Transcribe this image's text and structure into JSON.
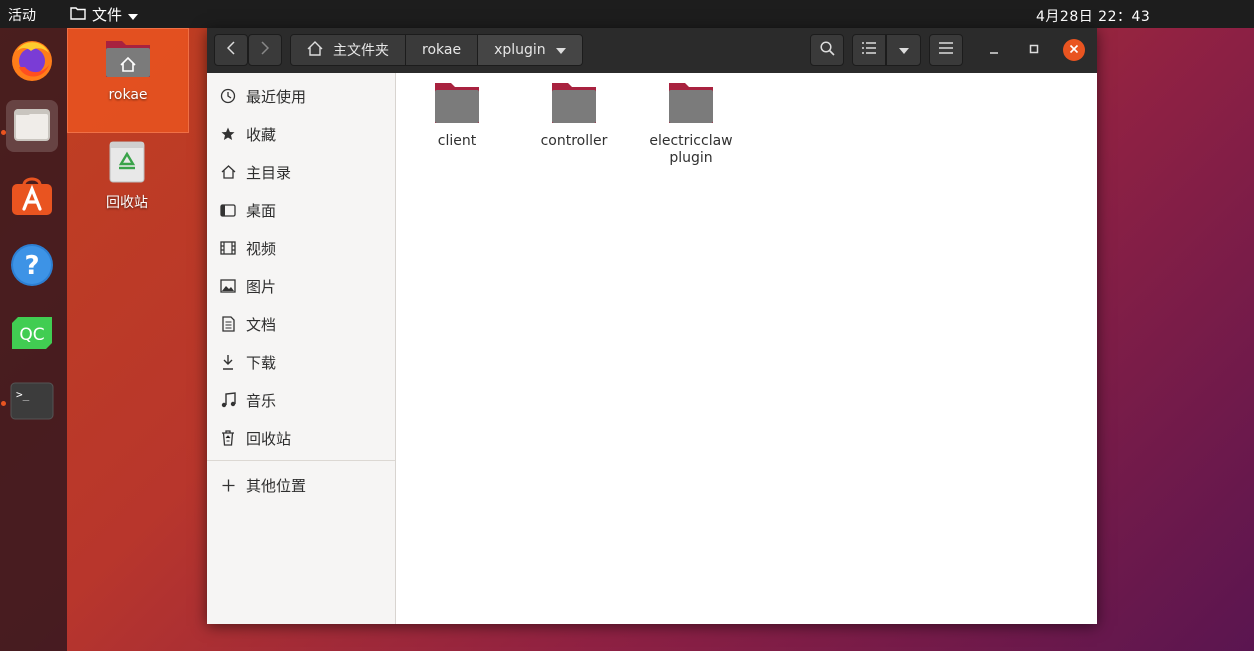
{
  "topbar": {
    "activities": "活动",
    "app_menu": "文件",
    "clock": "4月28日  22：43"
  },
  "dock": {
    "items": [
      {
        "icon": "firefox-icon"
      },
      {
        "icon": "files-icon"
      },
      {
        "icon": "software-icon"
      },
      {
        "icon": "help-icon"
      },
      {
        "icon": "qtcreator-icon",
        "label": "QC"
      },
      {
        "icon": "terminal-icon",
        "label": ">_"
      }
    ]
  },
  "desktop": {
    "icons": [
      {
        "label": "rokae"
      },
      {
        "label": "回收站"
      }
    ]
  },
  "window": {
    "breadcrumbs": [
      "主文件夹",
      "rokae",
      "xplugin"
    ],
    "sidebar": {
      "items": [
        {
          "label": "最近使用",
          "icon": "recent-icon"
        },
        {
          "label": "收藏",
          "icon": "star-icon"
        },
        {
          "label": "主目录",
          "icon": "home-icon"
        },
        {
          "label": "桌面",
          "icon": "desktop-icon"
        },
        {
          "label": "视频",
          "icon": "video-icon"
        },
        {
          "label": "图片",
          "icon": "picture-icon"
        },
        {
          "label": "文档",
          "icon": "document-icon"
        },
        {
          "label": "下载",
          "icon": "download-icon"
        },
        {
          "label": "音乐",
          "icon": "music-icon"
        },
        {
          "label": "回收站",
          "icon": "trash-icon"
        }
      ],
      "other_locations": "其他位置"
    },
    "files": [
      {
        "name": "client"
      },
      {
        "name": "controller"
      },
      {
        "name": "electricclaw plugin"
      }
    ]
  }
}
